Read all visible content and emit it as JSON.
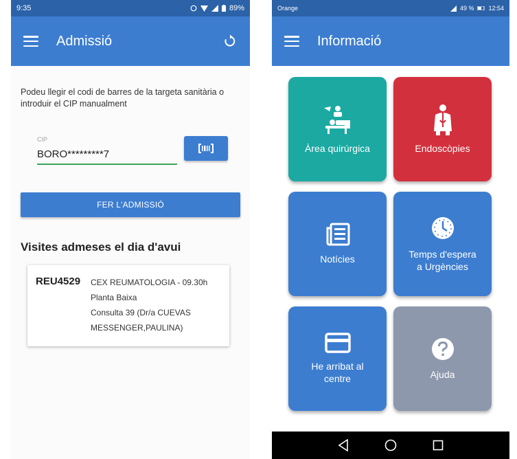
{
  "left": {
    "status": {
      "time": "9:35",
      "battery": "89%"
    },
    "title": "Admissió",
    "intro": "Podeu llegir el codi de barres de la targeta sanitària o introduir el CIP manualment",
    "cip": {
      "label": "CIP",
      "value": "BORO*********7"
    },
    "admit_button": "FER L'ADMISSIÓ",
    "visits_heading": "Visites admeses el dia d'avui",
    "visit": {
      "code": "REU4529",
      "lines": [
        "CEX REUMATOLOGIA - 09.30h",
        "Planta Baixa",
        "Consulta 39 (Dr/a CUEVAS",
        "MESSENGER,PAULINA)"
      ]
    }
  },
  "right": {
    "status": {
      "carrier": "Orange",
      "battery": "49 %",
      "time": "12:54"
    },
    "title": "Informació",
    "tiles": [
      {
        "label": "Àrea quirúrgica",
        "color": "#1ba9a2",
        "icon": "surgery-icon"
      },
      {
        "label": "Endoscòpies",
        "color": "#d3303d",
        "icon": "endoscopy-icon"
      },
      {
        "label": "Notícies",
        "color": "#3c7dd0",
        "icon": "news-icon"
      },
      {
        "label": "Temps d'espera a Urgències",
        "color": "#3c7dd0",
        "icon": "clock-icon"
      },
      {
        "label": "He arribat al centre",
        "color": "#3c7dd0",
        "icon": "card-icon"
      },
      {
        "label": "Ajuda",
        "color": "#8d98ad",
        "icon": "help-icon"
      }
    ]
  },
  "colors": {
    "appbar": "#3c7dd0",
    "statusbar": "#2b62a8",
    "input_underline": "#3aa356"
  }
}
